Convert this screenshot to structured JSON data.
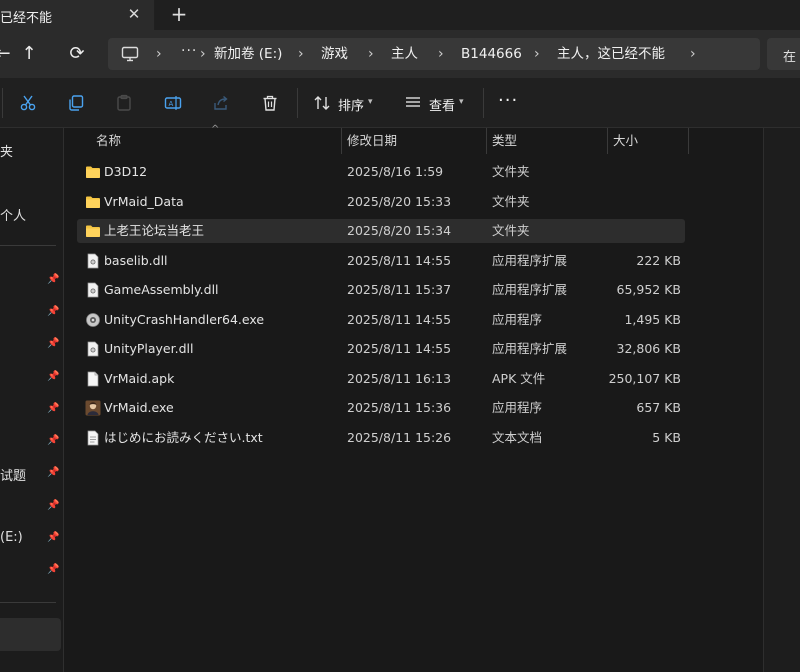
{
  "tab": {
    "title": "已经不能",
    "close": "✕",
    "new": "+"
  },
  "nav": {
    "back": "←",
    "up": "↑",
    "refresh": "⟳"
  },
  "address": {
    "more": "···",
    "crumbs": [
      "新加卷 (E:)",
      "游戏",
      "主人",
      "B144666",
      "主人，这已经不能"
    ],
    "search_placeholder": "在"
  },
  "toolbar": {
    "sort_label": "排序",
    "view_label": "查看",
    "more": "···",
    "icons": [
      "cut-icon",
      "copy-icon",
      "paste-icon",
      "rename-icon",
      "share-icon",
      "delete-icon"
    ]
  },
  "sidebar": {
    "items": [
      {
        "label": "夹"
      },
      {
        "label": "个人"
      },
      {
        "label": "试题"
      },
      {
        "label": "(E:)"
      }
    ]
  },
  "columns": {
    "name": "名称",
    "date": "修改日期",
    "type": "类型",
    "size": "大小"
  },
  "files": [
    {
      "icon": "folder-icon",
      "name": "D3D12",
      "date": "2025/8/16 1:59",
      "type": "文件夹",
      "size": ""
    },
    {
      "icon": "folder-icon",
      "name": "VrMaid_Data",
      "date": "2025/8/20 15:33",
      "type": "文件夹",
      "size": ""
    },
    {
      "icon": "folder-icon",
      "name": "上老王论坛当老王",
      "date": "2025/8/20 15:34",
      "type": "文件夹",
      "size": ""
    },
    {
      "icon": "dll-file-icon",
      "name": "baselib.dll",
      "date": "2025/8/11 14:55",
      "type": "应用程序扩展",
      "size": "222 KB"
    },
    {
      "icon": "dll-file-icon",
      "name": "GameAssembly.dll",
      "date": "2025/8/11 15:37",
      "type": "应用程序扩展",
      "size": "65,952 KB"
    },
    {
      "icon": "gear-exe-icon",
      "name": "UnityCrashHandler64.exe",
      "date": "2025/8/11 14:55",
      "type": "应用程序",
      "size": "1,495 KB"
    },
    {
      "icon": "dll-file-icon",
      "name": "UnityPlayer.dll",
      "date": "2025/8/11 14:55",
      "type": "应用程序扩展",
      "size": "32,806 KB"
    },
    {
      "icon": "blank-file-icon",
      "name": "VrMaid.apk",
      "date": "2025/8/11 16:13",
      "type": "APK 文件",
      "size": "250,107 KB"
    },
    {
      "icon": "app-exe-icon",
      "name": "VrMaid.exe",
      "date": "2025/8/11 15:36",
      "type": "应用程序",
      "size": "657 KB"
    },
    {
      "icon": "text-file-icon",
      "name": "はじめにお読みください.txt",
      "date": "2025/8/11 15:26",
      "type": "文本文档",
      "size": "5 KB"
    }
  ],
  "colors": {
    "folder": "#f4c542",
    "hover_row": "#2d2d2d",
    "background": "#191919"
  }
}
